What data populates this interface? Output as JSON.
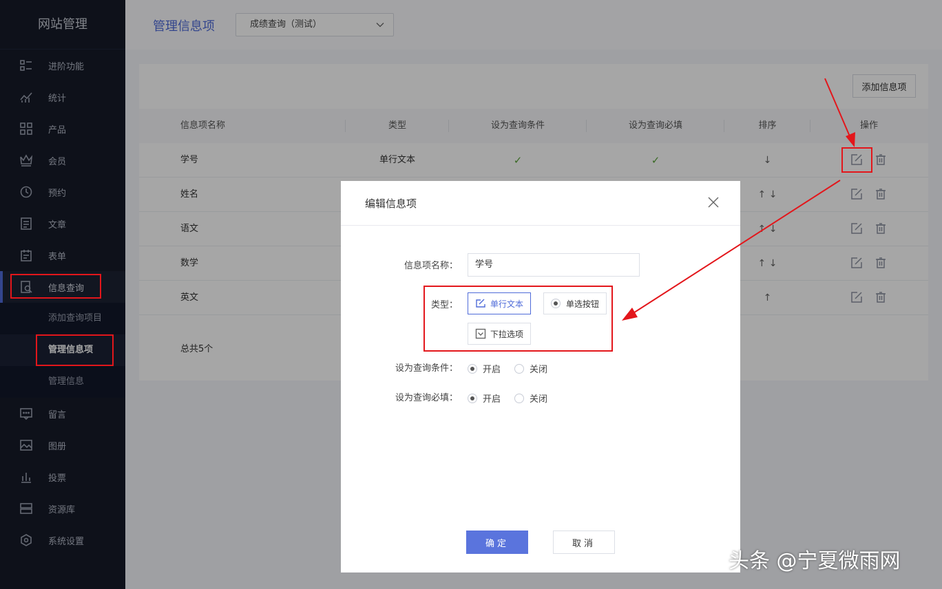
{
  "sidebar": {
    "brand": "网站管理",
    "items": [
      {
        "label": "进阶功能",
        "icon": "list-icon"
      },
      {
        "label": "统计",
        "icon": "stats-icon"
      },
      {
        "label": "产品",
        "icon": "grid-icon"
      },
      {
        "label": "会员",
        "icon": "crown-icon"
      },
      {
        "label": "预约",
        "icon": "clock-icon"
      },
      {
        "label": "文章",
        "icon": "document-icon"
      },
      {
        "label": "表单",
        "icon": "form-icon"
      },
      {
        "label": "信息查询",
        "icon": "search-doc-icon"
      }
    ],
    "subitems": [
      "添加查询项目",
      "管理信息项",
      "管理信息"
    ],
    "items_after": [
      {
        "label": "留言",
        "icon": "message-icon"
      },
      {
        "label": "图册",
        "icon": "image-icon"
      },
      {
        "label": "投票",
        "icon": "bar-chart-icon"
      },
      {
        "label": "资源库",
        "icon": "database-icon"
      },
      {
        "label": "系统设置",
        "icon": "settings-icon"
      }
    ]
  },
  "header": {
    "title": "管理信息项",
    "select_value": "成绩查询（测试）"
  },
  "card": {
    "add_button": "添加信息项",
    "columns": [
      "信息项名称",
      "类型",
      "设为查询条件",
      "设为查询必填",
      "排序",
      "操作"
    ],
    "rows": [
      {
        "name": "学号",
        "type": "单行文本",
        "condition": "✓",
        "required": "✓",
        "sort": "↓"
      },
      {
        "name": "姓名",
        "type": "",
        "condition": "",
        "required": "",
        "sort": "↑ ↓"
      },
      {
        "name": "语文",
        "type": "",
        "condition": "",
        "required": "",
        "sort": "↑ ↓"
      },
      {
        "name": "数学",
        "type": "",
        "condition": "",
        "required": "",
        "sort": "↑ ↓"
      },
      {
        "name": "英文",
        "type": "",
        "condition": "",
        "required": "",
        "sort": "↑"
      }
    ],
    "total": "总共5个"
  },
  "modal": {
    "title": "编辑信息项",
    "name_label": "信息项名称：",
    "name_value": "学号",
    "type_label": "类型：",
    "type_options": [
      "单行文本",
      "单选按钮",
      "下拉选项"
    ],
    "type_selected": "单行文本",
    "condition_label": "设为查询条件：",
    "required_label": "设为查询必填：",
    "on_label": "开启",
    "off_label": "关闭",
    "confirm": "确定",
    "cancel": "取消"
  },
  "watermark": "头条 @宁夏微雨网",
  "colors": {
    "sidebar_bg": "#161b29",
    "accent": "#4f6bd9",
    "annotation_red": "#e3161b",
    "check_green": "#5aa33a"
  }
}
